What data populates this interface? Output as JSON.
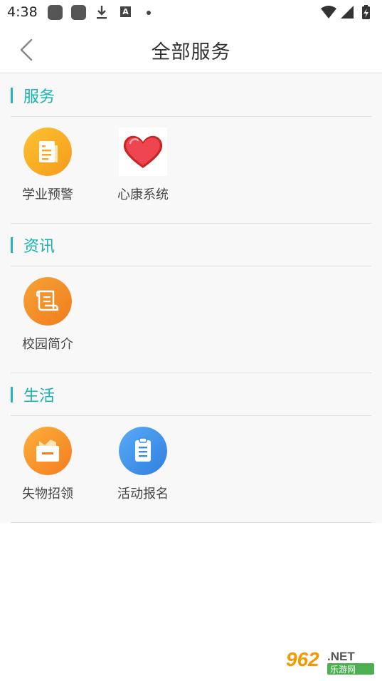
{
  "status_bar": {
    "time": "4:38",
    "notification_icons": [
      "app-notification-icon",
      "app-notification-icon",
      "download-icon",
      "font-icon",
      "dot-icon"
    ],
    "system_icons": [
      "wifi-icon",
      "signal-icon",
      "battery-charging-icon"
    ]
  },
  "header": {
    "title": "全部服务",
    "back_icon": "chevron-left-icon"
  },
  "sections": [
    {
      "title": "服务",
      "items": [
        {
          "label": "学业预警",
          "icon": "document-icon",
          "color": "#f9a825"
        },
        {
          "label": "心康系统",
          "icon": "heart-icon",
          "color": "#e53935"
        }
      ]
    },
    {
      "title": "资讯",
      "items": [
        {
          "label": "校园简介",
          "icon": "scroll-icon",
          "color": "#f28c28"
        }
      ]
    },
    {
      "title": "生活",
      "items": [
        {
          "label": "失物招领",
          "icon": "box-icon",
          "color": "#f7941d"
        },
        {
          "label": "活动报名",
          "icon": "clipboard-icon",
          "color": "#3d8ee8"
        }
      ]
    }
  ],
  "watermark": {
    "brand": "962",
    "suffix": ".NET",
    "tagline": "乐游网"
  },
  "colors": {
    "accent": "#1ab1b4",
    "background": "#f8f8f8"
  }
}
